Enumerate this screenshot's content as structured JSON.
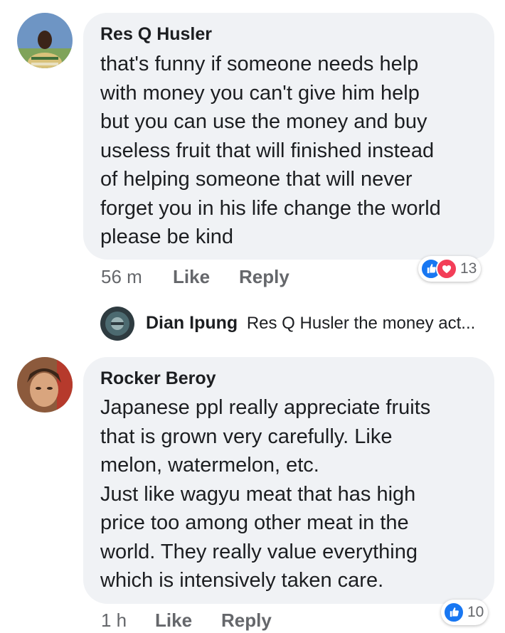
{
  "colors": {
    "bubble": "#f0f2f5",
    "meta_text": "#65676b",
    "like_blue": "#1877f2",
    "love_red": "#f33e58"
  },
  "comments": [
    {
      "author": "Res Q Husler",
      "text": "that's funny if someone needs help\nwith money you can't give him help\nbut you  can use the money and buy\nuseless fruit that will finished instead\nof helping someone that will never\nforget you in his life change the world\nplease be kind",
      "time": "56 m",
      "like_label": "Like",
      "reply_label": "Reply",
      "reactions": {
        "icons": [
          "like-icon",
          "love-icon"
        ],
        "count": "13"
      },
      "reply_preview": {
        "author": "Dian Ipung",
        "text": "Res Q Husler the money act..."
      }
    },
    {
      "author": "Rocker Beroy",
      "text": "Japanese ppl really appreciate fruits\nthat is grown very carefully. Like\nmelon, watermelon, etc.\nJust like wagyu meat that has high\nprice too among other meat in the\nworld. They really value everything\nwhich is intensively taken care.",
      "time": "1 h",
      "like_label": "Like",
      "reply_label": "Reply",
      "reactions": {
        "icons": [
          "like-icon"
        ],
        "count": "10"
      }
    }
  ]
}
